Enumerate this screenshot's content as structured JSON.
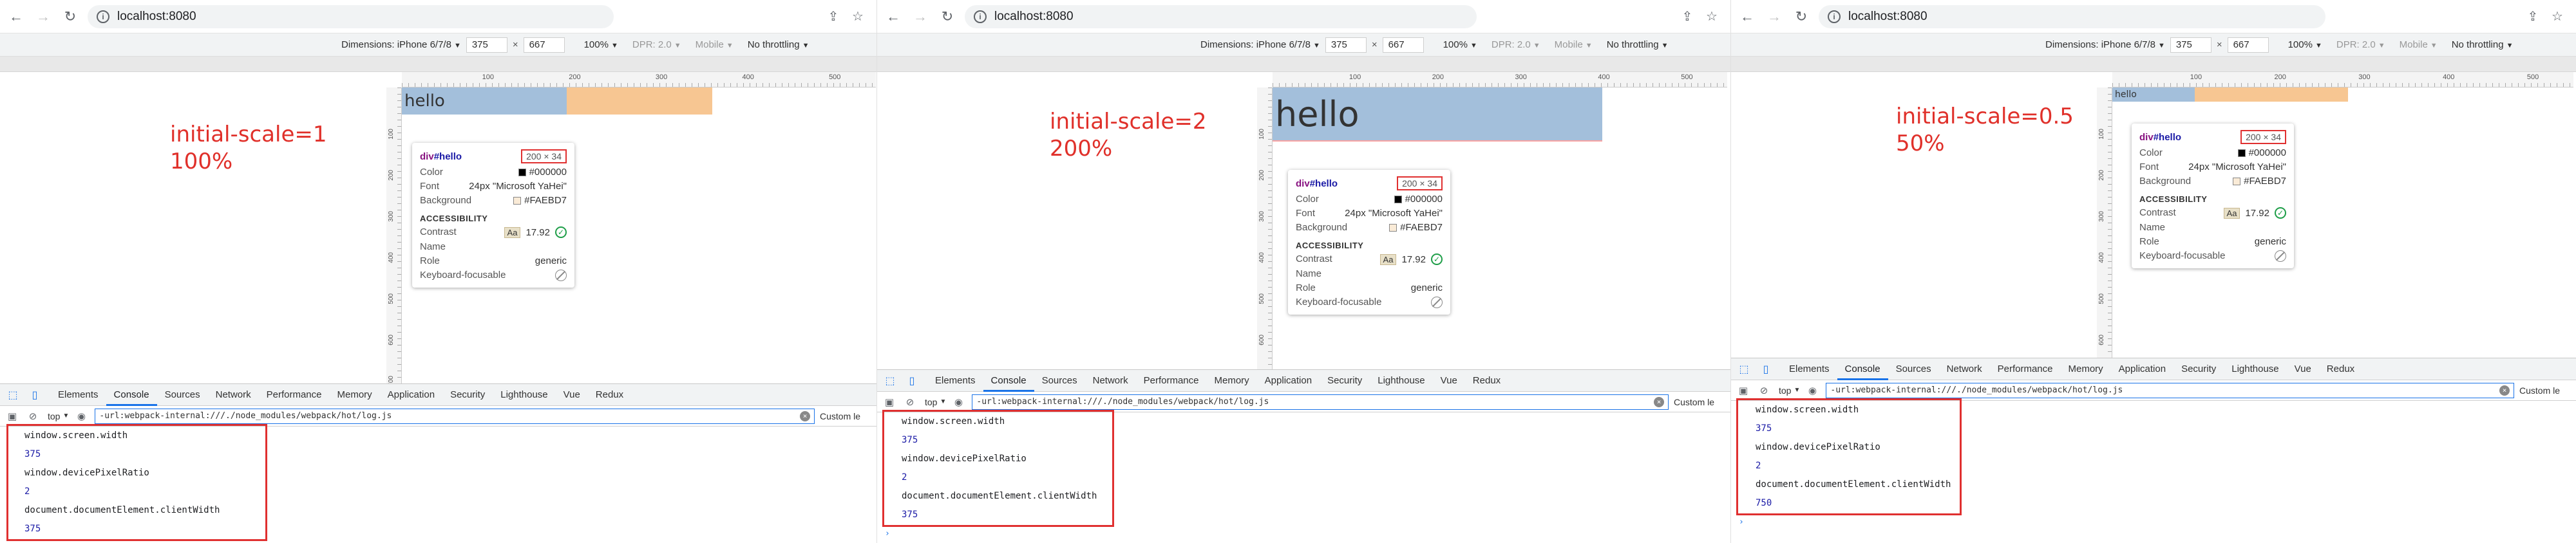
{
  "browser": {
    "back_icon": "arrow-left-icon",
    "forward_icon": "arrow-right-icon",
    "reload_icon": "reload-icon",
    "url": "localhost:8080",
    "share_icon": "share-icon",
    "star_icon": "star-icon"
  },
  "device_toolbar": {
    "dimensions_label": "Dimensions: iPhone 6/7/8",
    "width_value": "375",
    "times": "×",
    "height_value": "667",
    "zoom": "100%",
    "dpr": "DPR: 2.0",
    "mobile": "Mobile",
    "throttling": "No throttling"
  },
  "ruler_labels": [
    "100",
    "200",
    "300",
    "400",
    "500"
  ],
  "vruler_labels": [
    "100",
    "200",
    "300",
    "400",
    "500",
    "600",
    "700",
    "800"
  ],
  "panels": [
    {
      "annotation_line1": "initial-scale=1",
      "annotation_line2": "100%",
      "hello_text": "hello",
      "console_results": [
        "375",
        "2",
        "375"
      ]
    },
    {
      "annotation_line1": "initial-scale=2",
      "annotation_line2": "200%",
      "hello_text": "hello",
      "console_results": [
        "375",
        "2",
        "375"
      ]
    },
    {
      "annotation_line1": "initial-scale=0.5",
      "annotation_line2": "50%",
      "hello_text": "hello",
      "console_results": [
        "375",
        "2",
        "750"
      ]
    }
  ],
  "tooltip": {
    "element": "div",
    "id": "#hello",
    "size": "200 × 34",
    "color_label": "Color",
    "color_value": "#000000",
    "font_label": "Font",
    "font_value": "24px \"Microsoft YaHei\"",
    "background_label": "Background",
    "background_value": "#FAEBD7",
    "accessibility_heading": "ACCESSIBILITY",
    "contrast_label": "Contrast",
    "contrast_aa": "Aa",
    "contrast_value": "17.92",
    "name_label": "Name",
    "role_label": "Role",
    "role_value": "generic",
    "keyboard_label": "Keyboard-focusable",
    "colors": {
      "color_swatch": "#000000",
      "background_swatch": "#FAEBD7"
    }
  },
  "devtools": {
    "tabs": [
      "Elements",
      "Console",
      "Sources",
      "Network",
      "Performance",
      "Memory",
      "Application",
      "Security",
      "Lighthouse",
      "Vue",
      "Redux"
    ],
    "active_tab": "Console",
    "context": "top",
    "filter_value": "-url:webpack-internal:///./node_modules/webpack/hot/log.js",
    "levels_label": "Custom le",
    "console_expressions": [
      "window.screen.width",
      "window.devicePixelRatio",
      "document.documentElement.clientWidth"
    ]
  },
  "colors": {
    "annotation": "#e0302a",
    "highlight_frame": "#e03030",
    "hello_content": "#a3bfdb",
    "hello_margin": "#f7c692",
    "accent": "#1a73e8"
  }
}
